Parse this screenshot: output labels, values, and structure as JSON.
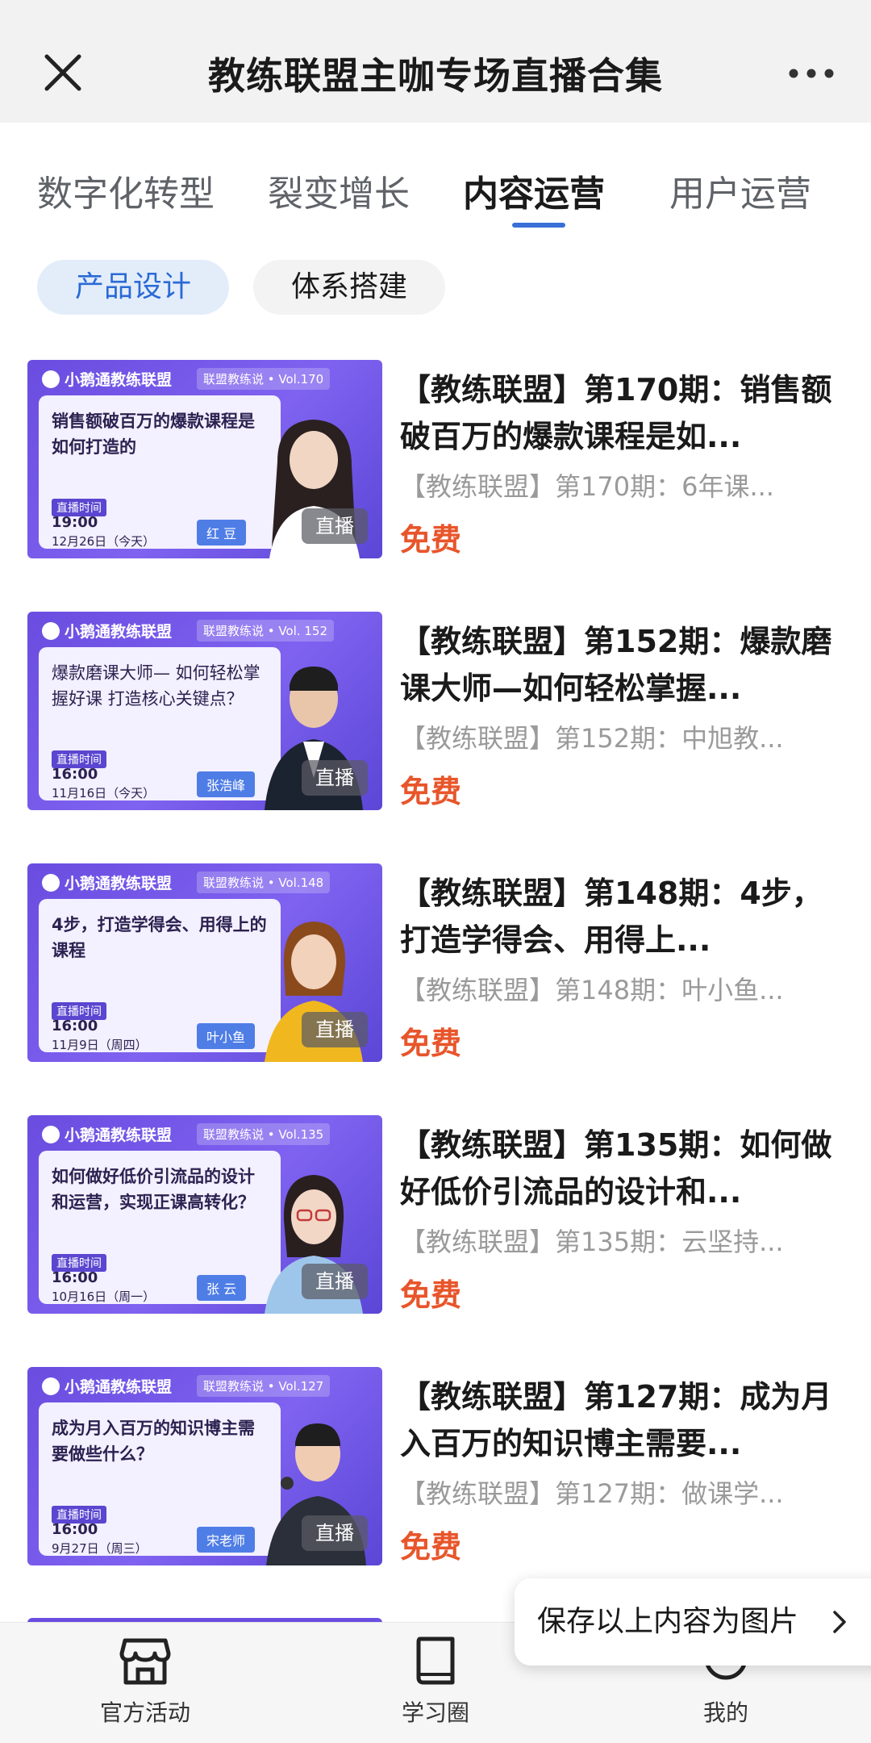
{
  "header": {
    "title": "教练联盟主咖专场直播合集"
  },
  "tabs": [
    {
      "label": "数字化转型",
      "active": false
    },
    {
      "label": "裂变增长",
      "active": false
    },
    {
      "label": "内容运营",
      "active": true
    },
    {
      "label": "用户运营",
      "active": false
    }
  ],
  "subtabs": [
    {
      "label": "产品设计",
      "active": true
    },
    {
      "label": "体系搭建",
      "active": false
    }
  ],
  "items": [
    {
      "title": "【教练联盟】第170期：销售额破百万的爆款课程是如...",
      "subtitle": "【教练联盟】第170期：6年课...",
      "price": "免费",
      "badge": "直播",
      "thumb": {
        "brand": "小鹅通教练联盟",
        "vol": "联盟教练说 • Vol.170",
        "headline": "销售额破百万的爆款课程是如何打造的",
        "time_label": "直播时间",
        "time": "19:00",
        "date": "12月26日（今天）",
        "name": "红 豆"
      }
    },
    {
      "title": "【教练联盟】第152期：爆款磨课大师—如何轻松掌握...",
      "subtitle": "【教练联盟】第152期：中旭教...",
      "price": "免费",
      "badge": "直播",
      "thumb": {
        "brand": "小鹅通教练联盟",
        "vol": "联盟教练说 • Vol. 152",
        "headline": "爆款磨课大师— 如何轻松掌握好课 打造核心关键点？",
        "time_label": "直播时间",
        "time": "16:00",
        "date": "11月16日（今天）",
        "name": "张浩峰"
      }
    },
    {
      "title": "【教练联盟】第148期：4步，打造学得会、用得上...",
      "subtitle": "【教练联盟】第148期：叶小鱼...",
      "price": "免费",
      "badge": "直播",
      "thumb": {
        "brand": "小鹅通教练联盟",
        "vol": "联盟教练说 • Vol.148",
        "headline": "4步，打造学得会、用得上的课程",
        "time_label": "直播时间",
        "time": "16:00",
        "date": "11月9日（周四）",
        "name": "叶小鱼"
      }
    },
    {
      "title": "【教练联盟】第135期：如何做好低价引流品的设计和...",
      "subtitle": "【教练联盟】第135期：云坚持...",
      "price": "免费",
      "badge": "直播",
      "thumb": {
        "brand": "小鹅通教练联盟",
        "vol": "联盟教练说 • Vol.135",
        "headline": "如何做好低价引流品的设计和运营，实现正课高转化？",
        "time_label": "直播时间",
        "time": "16:00",
        "date": "10月16日（周一）",
        "name": "张 云"
      }
    },
    {
      "title": "【教练联盟】第127期：成为月入百万的知识博主需要...",
      "subtitle": "【教练联盟】第127期：做课学...",
      "price": "免费",
      "badge": "直播",
      "thumb": {
        "brand": "小鹅通教练联盟",
        "vol": "联盟教练说 • Vol.127",
        "headline": "成为月入百万的知识博主需要做些什么？",
        "time_label": "直播时间",
        "time": "16:00",
        "date": "9月27日（周三）",
        "name": "宋老师"
      }
    }
  ],
  "bottom_nav": [
    {
      "label": "官方活动",
      "icon": "shop-icon"
    },
    {
      "label": "学习圈",
      "icon": "book-icon"
    },
    {
      "label": "我的",
      "icon": "profile-icon"
    }
  ],
  "save_button": {
    "label": "保存以上内容为图片"
  },
  "colors": {
    "accent": "#3a6fd8",
    "price": "#e8552b",
    "thumb_purple": "#6a4de0"
  }
}
